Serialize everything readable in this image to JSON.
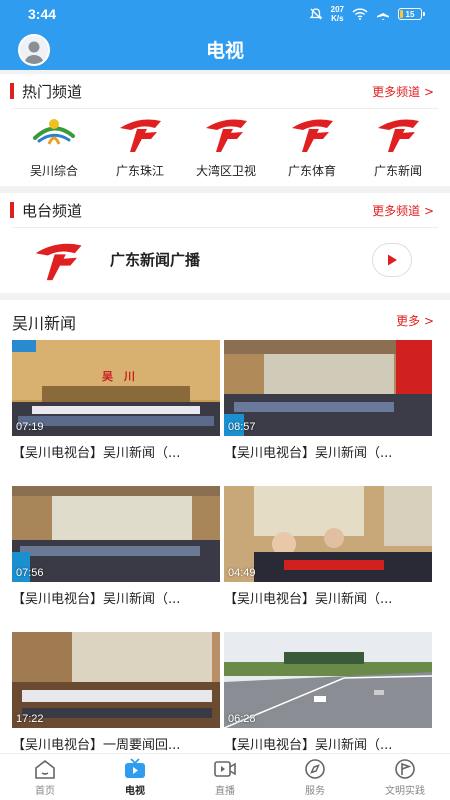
{
  "status_bar": {
    "time": "3:44",
    "net_speed_value": "207",
    "net_speed_unit": "K/s",
    "battery": "15"
  },
  "app_bar": {
    "title": "电视"
  },
  "hot_channels": {
    "title": "热门频道",
    "more": "更多频道 >",
    "items": [
      {
        "name": "吴川综合",
        "icon": "wuchuan-logo"
      },
      {
        "name": "广东珠江",
        "icon": "gdtv-logo"
      },
      {
        "name": "大湾区卫视",
        "icon": "gdtv-logo"
      },
      {
        "name": "广东体育",
        "icon": "gdtv-logo"
      },
      {
        "name": "广东新闻",
        "icon": "gdtv-logo"
      }
    ]
  },
  "radio": {
    "title": "电台频道",
    "more": "更多频道 >",
    "station": "广东新闻广播"
  },
  "news": {
    "title": "吴川新闻",
    "more": "更多 >",
    "items": [
      {
        "duration": "07:19",
        "caption": "【吴川电视台】吴川新闻（...",
        "banner": "吴　川"
      },
      {
        "duration": "08:57",
        "caption": "【吴川电视台】吴川新闻（..."
      },
      {
        "duration": "07:56",
        "caption": "【吴川电视台】吴川新闻（..."
      },
      {
        "duration": "04:49",
        "caption": "【吴川电视台】吴川新闻（..."
      },
      {
        "duration": "17:22",
        "caption": "【吴川电视台】一周要闻回..."
      },
      {
        "duration": "06:28",
        "caption": "【吴川电视台】吴川新闻（..."
      }
    ]
  },
  "tabs": [
    {
      "label": "首页",
      "icon": "home-icon",
      "active": false
    },
    {
      "label": "电视",
      "icon": "tv-icon",
      "active": true
    },
    {
      "label": "直播",
      "icon": "live-icon",
      "active": false
    },
    {
      "label": "服务",
      "icon": "compass-icon",
      "active": false
    },
    {
      "label": "文明实践",
      "icon": "flag-icon",
      "active": false
    }
  ],
  "colors": {
    "primary": "#2f9cf0",
    "accent_red": "#e02020"
  }
}
